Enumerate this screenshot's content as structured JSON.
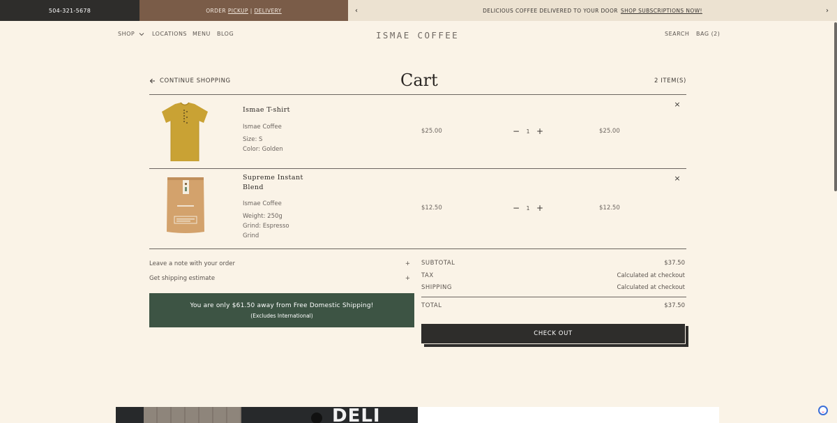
{
  "topbar": {
    "phone": "504-321-5678",
    "order_prefix": "ORDER",
    "pickup": "PICKUP",
    "separator": "|",
    "delivery": "DELIVERY",
    "promo": "DELICIOUS COFFEE DELIVERED TO YOUR DOOR",
    "promo_link": "SHOP SUBSCRIPTIONS NOW!",
    "prev_glyph": "‹",
    "next_glyph": "›"
  },
  "nav": {
    "shop": "SHOP",
    "locations": "LOCATIONS",
    "menu": "MENU",
    "blog": "BLOG",
    "brand": "ISMAE COFFEE",
    "search": "SEARCH",
    "bag": "BAG (2)"
  },
  "cart": {
    "title": "Cart",
    "continue": "CONTINUE SHOPPING",
    "count": "2 ITEM(S)",
    "items": [
      {
        "name": "Ismae T-shirt",
        "vendor": "Ismae Coffee",
        "option1": "Size: S",
        "option2": "Color: Golden",
        "price": "$25.00",
        "qty": "1",
        "total": "$25.00"
      },
      {
        "name": "Supreme Instant Blend",
        "vendor": "Ismae Coffee",
        "option1": "Weight: 250g",
        "option2": "Grind: Espresso Grind",
        "price": "$12.50",
        "qty": "1",
        "total": "$12.50"
      }
    ],
    "note_label": "Leave a note with your order",
    "shipping_estimate_label": "Get shipping estimate",
    "plus": "+",
    "minus": "−",
    "remove": "×"
  },
  "banner": {
    "line1": "You are only $61.50 away from Free Domestic Shipping!",
    "line2": "(Excludes International)"
  },
  "summary": {
    "subtotal_label": "SUBTOTAL",
    "subtotal_value": "$37.50",
    "tax_label": "TAX",
    "tax_value": "Calculated at checkout",
    "shipping_label": "SHIPPING",
    "shipping_value": "Calculated at checkout",
    "total_label": "TOTAL",
    "total_value": "$37.50",
    "checkout": "CHECK OUT"
  },
  "footer_image": {
    "sign_text": "DELI"
  },
  "colors": {
    "background": "#faf3e7",
    "dark": "#2e2d2b",
    "brown": "#7a5c48",
    "green": "#3d5444",
    "shirt": "#c9a234",
    "bag": "#d3a26c"
  }
}
